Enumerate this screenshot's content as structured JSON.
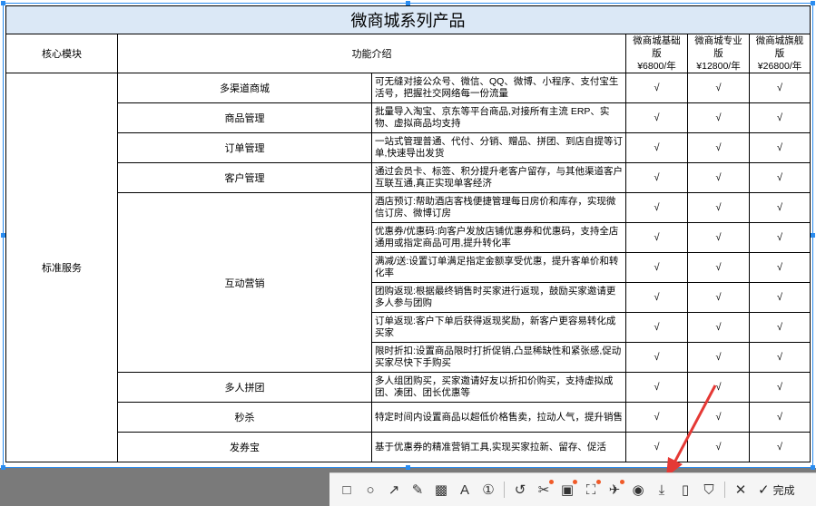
{
  "table": {
    "title": "微商城系列产品",
    "headers": {
      "module": "核心模块",
      "feature": "功能介绍",
      "tiers": [
        {
          "name": "微商城基础版",
          "price": "¥6800/年"
        },
        {
          "name": "微商城专业版",
          "price": "¥12800/年"
        },
        {
          "name": "微商城旗舰版",
          "price": "¥26800/年"
        }
      ]
    },
    "section": "标准服务",
    "rows": [
      {
        "feature": "多渠道商城",
        "desc": "可无缝对接公众号、微信、QQ、微博、小程序、支付宝生活号，把握社交网络每一份流量"
      },
      {
        "feature": "商品管理",
        "desc": "批量导入淘宝、京东等平台商品,对接所有主流 ERP、实物、虚拟商品均支持"
      },
      {
        "feature": "订单管理",
        "desc": "一站式管理普通、代付、分销、赠品、拼团、到店自提等订单,快速导出发货"
      },
      {
        "feature": "客户管理",
        "desc": "通过会员卡、标签、积分提升老客户留存，与其他渠道客户互联互通,真正实现单客经济"
      },
      {
        "feature": "互动营销",
        "desc": "酒店预订:帮助酒店客栈便捷管理每日房价和库存，实现微信订房、微博订房"
      },
      {
        "feature": "",
        "desc": "优惠券/优惠码:向客户发放店铺优惠券和优惠码，支持全店通用或指定商品可用,提升转化率"
      },
      {
        "feature": "",
        "desc": "满减/送:设置订单满足指定金额享受优惠，提升客单价和转化率"
      },
      {
        "feature": "",
        "desc": "团购返现:根据最终销售时买家进行返现，鼓励买家邀请更多人参与团购"
      },
      {
        "feature": "",
        "desc": "订单返现:客户下单后获得返现奖励，新客户更容易转化成买家"
      },
      {
        "feature": "",
        "desc": "限时折扣:设置商品限时打折促销,凸显稀缺性和紧张感,促动买家尽快下手购买"
      },
      {
        "feature": "多人拼团",
        "desc": "多人组团购买，买家邀请好友以折扣价购买，支持虚拟成团、凑团、团长优惠等"
      },
      {
        "feature": "秒杀",
        "desc": "特定时间内设置商品以超低价格售卖，拉动人气，提升销售"
      },
      {
        "feature": "发券宝",
        "desc": "基于优惠券的精准营销工具,实现买家拉新、留存、促活"
      }
    ],
    "check": "√"
  },
  "toolbar": {
    "tools": [
      {
        "name": "rectangle-tool",
        "glyph": "□"
      },
      {
        "name": "ellipse-tool",
        "glyph": "○"
      },
      {
        "name": "arrow-tool",
        "glyph": "↗"
      },
      {
        "name": "pen-tool",
        "glyph": "✎"
      },
      {
        "name": "mosaic-tool",
        "glyph": "▩"
      },
      {
        "name": "text-tool",
        "glyph": "A"
      },
      {
        "name": "number-tool",
        "glyph": "①"
      }
    ],
    "tools2": [
      {
        "name": "undo-tool",
        "glyph": "↺"
      },
      {
        "name": "cut-tool",
        "glyph": "✂"
      },
      {
        "name": "ocr-tool",
        "glyph": "▣"
      },
      {
        "name": "scan-tool",
        "glyph": "⛶"
      },
      {
        "name": "pin-tool",
        "glyph": "✈"
      },
      {
        "name": "record-tool",
        "glyph": "◉"
      },
      {
        "name": "download-tool",
        "glyph": "⤓"
      },
      {
        "name": "phone-tool",
        "glyph": "▯"
      },
      {
        "name": "bookmark-tool",
        "glyph": "⛉"
      }
    ],
    "close_glyph": "✕",
    "done_glyph": "✓",
    "done_label": "完成"
  },
  "colors": {
    "accent": "#2a8cf0",
    "title_bg": "#dbe8f6",
    "annotation": "#e53935"
  }
}
